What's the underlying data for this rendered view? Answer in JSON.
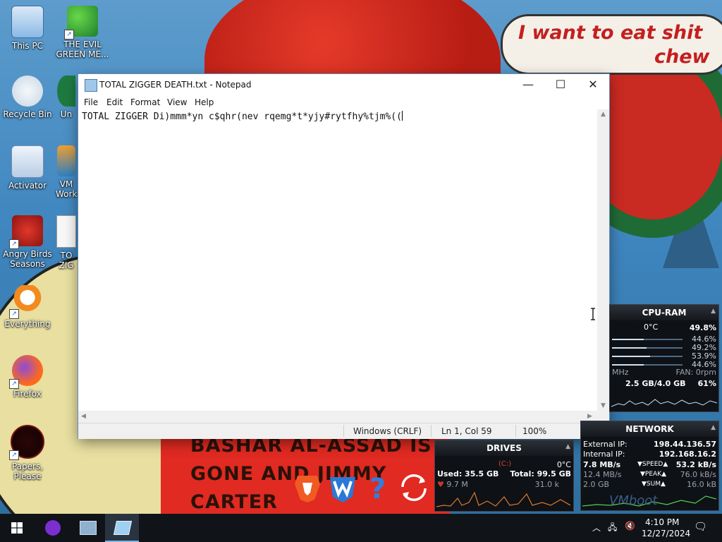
{
  "desktop": {
    "icons": [
      {
        "label": "This PC",
        "icon": "this-pc-icon"
      },
      {
        "label": "THE EVIL GREEN ME...",
        "icon": "msn-people-icon"
      },
      {
        "label": "Recycle Bin",
        "icon": "recycle-bin-icon"
      },
      {
        "label": "Un",
        "icon": "uninstaller-icon"
      },
      {
        "label": "Activator",
        "icon": "activator-icon"
      },
      {
        "label": "VM Work",
        "icon": "vmware-icon"
      },
      {
        "label": "Angry Birds Seasons",
        "icon": "angry-birds-icon"
      },
      {
        "label": "TO ZIG",
        "icon": "text-file-icon"
      },
      {
        "label": "Everything",
        "icon": "search-magnifier-icon"
      },
      {
        "label": "Firefox",
        "icon": "firefox-icon"
      },
      {
        "label": "Papers, Please",
        "icon": "papers-please-icon"
      }
    ],
    "wallpaper_text": {
      "sign_line1": "I want to eat shit",
      "sign_line2": "chew",
      "banner": [
        "BASHAR AL-ASSAD IS",
        "GONE AND JIMMY",
        "CARTER"
      ]
    }
  },
  "notepad": {
    "title": "TOTAL ZIGGER DEATH.txt - Notepad",
    "menu": [
      "File",
      "Edit",
      "Format",
      "View",
      "Help"
    ],
    "content": "TOTAL ZIGGER Di)mmm*yn c$qhr(nev rqemg*t*yjy#rytfhy%tjm%((",
    "status": {
      "line_ending": "Windows (CRLF)",
      "position": "Ln 1, Col 59",
      "zoom": "100%"
    },
    "controls": {
      "minimize": "—",
      "maximize": "☐",
      "close": "✕"
    }
  },
  "gadgets": {
    "cpu_ram": {
      "title": "CPU-RAM",
      "temp": "0°C",
      "total": "49.8%",
      "cores": [
        "44.6%",
        "49.2%",
        "53.9%",
        "44.6%"
      ],
      "core_levels": [
        0.45,
        0.49,
        0.54,
        0.45
      ],
      "mhz_label": "MHz",
      "fan": "FAN: 0rpm",
      "ram": "2.5 GB/4.0 GB",
      "ram_pct": "61%"
    },
    "network": {
      "title": "NETWORK",
      "external_label": "External IP:",
      "external_ip": "198.44.136.57",
      "internal_label": "Internal IP:",
      "internal_ip": "192.168.16.2",
      "down_speed": "7.8 MB/s",
      "speed_label": "SPEED",
      "up_speed": "53.2 kB/s",
      "down_peak": "12.4 MB/s",
      "peak_label": "PEAK",
      "up_peak": "76.0 kB/s",
      "down_sum": "2.0 GB",
      "sum_label": "SUM",
      "up_sum": "16.0 kB",
      "watermark": "VMboot"
    },
    "drives": {
      "title": "DRIVES",
      "drive_letter": "(C:)",
      "temp": "0°C",
      "used": "Used: 35.5 GB",
      "total": "Total: 99.5 GB",
      "read": "9.7 M",
      "write": "31.0 k"
    }
  },
  "quick_launch": [
    "brave-icon",
    "wise-care-icon",
    "help-question-icon",
    "sync-refresh-icon"
  ],
  "taskbar": {
    "start_icon": "windows-logo-icon",
    "apps": [
      "aol-instant-icon",
      "network-computer-icon",
      "notepad-icon"
    ],
    "time": "4:10 PM",
    "date": "12/27/2024"
  },
  "colors": {
    "accent": "#0078d7",
    "taskbar": "#101418",
    "gadget_bg": "#0e1116"
  }
}
